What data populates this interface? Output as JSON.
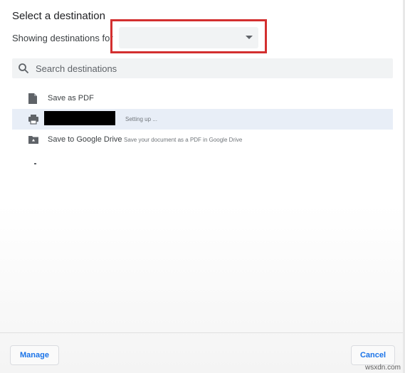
{
  "dialog": {
    "title": "Select a destination",
    "showing_label": "Showing destinations for",
    "selected_account": "",
    "accent_color": "#1a73e8",
    "highlight_color": "#d32f2f"
  },
  "search": {
    "placeholder": "Search destinations",
    "value": ""
  },
  "destinations": [
    {
      "icon": "pdf-file-icon",
      "name": "Save as PDF",
      "sub": ""
    },
    {
      "icon": "printer-icon",
      "name": "",
      "sub": "Setting up ...",
      "selected": true
    },
    {
      "icon": "google-drive-folder-icon",
      "name": "Save to Google Drive",
      "sub": "Save your document as a PDF in Google Drive"
    }
  ],
  "footer": {
    "manage_label": "Manage",
    "cancel_label": "Cancel"
  },
  "watermark": "wsxdn.com"
}
